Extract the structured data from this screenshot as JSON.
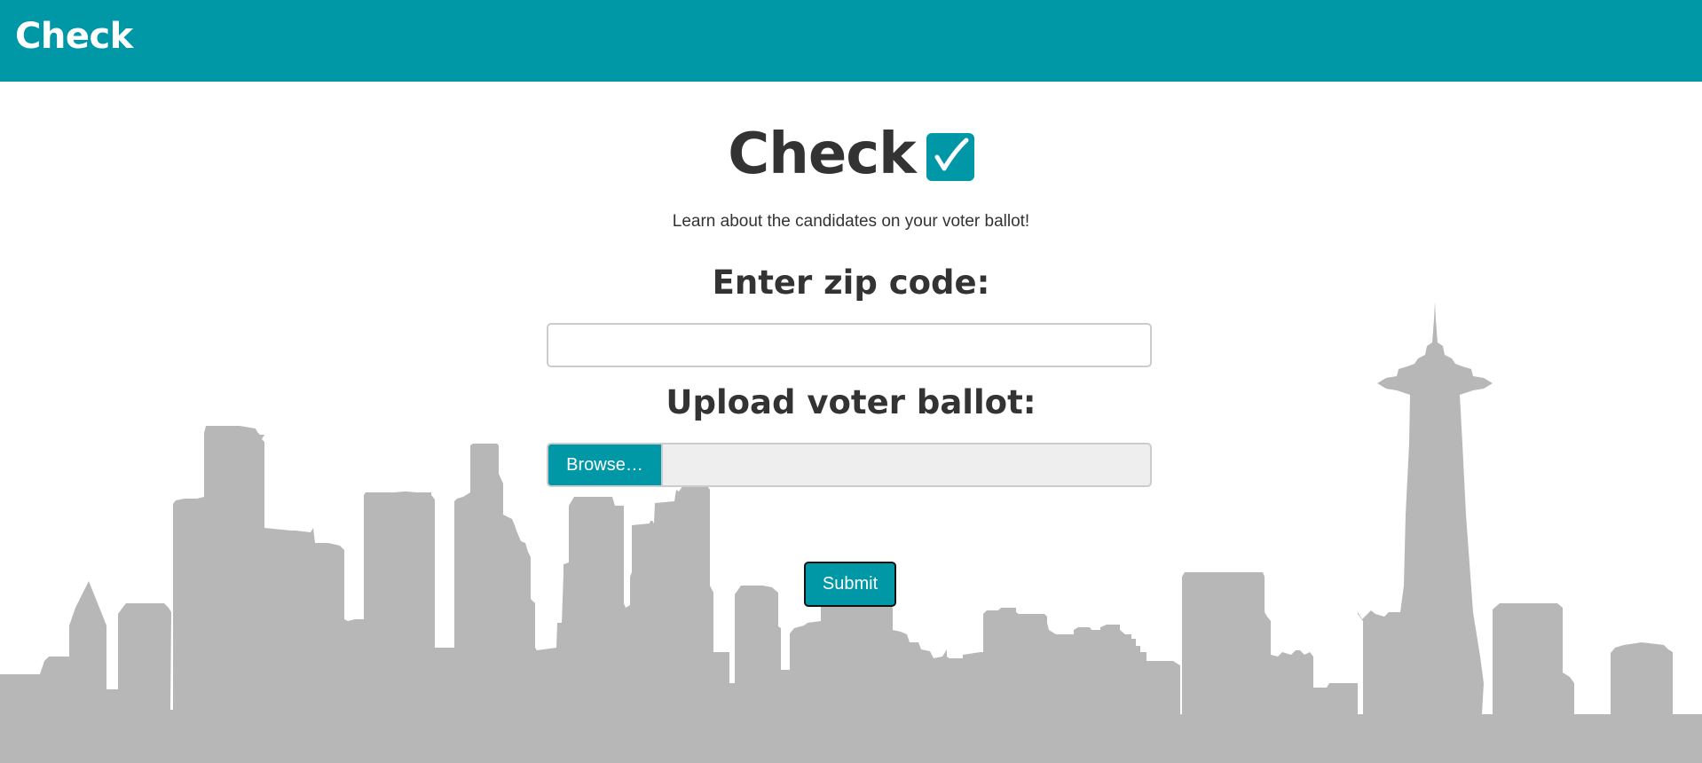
{
  "navbar": {
    "brand": "Check",
    "color": "#0097a7"
  },
  "hero": {
    "title": "Check",
    "check_icon": "check-box-icon",
    "tagline": "Learn about the candidates on your voter ballot!"
  },
  "form": {
    "zip_label": "Enter zip code:",
    "zip_value": "",
    "zip_placeholder": "",
    "upload_label": "Upload voter ballot:",
    "browse_label": "Browse…",
    "file_name": "",
    "submit_label": "Submit"
  },
  "background": {
    "image": "city-skyline-illustration",
    "color": "#b7b7b7"
  }
}
